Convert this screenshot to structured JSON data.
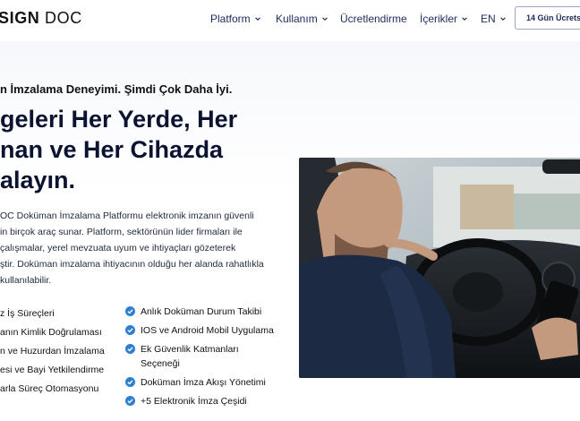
{
  "header": {
    "logo_bold": "SIGN",
    "logo_light": "DOC",
    "nav": [
      {
        "label": "Platform",
        "has_dropdown": true
      },
      {
        "label": "Kullanım",
        "has_dropdown": true
      },
      {
        "label": "Ücretlendirme",
        "has_dropdown": false
      },
      {
        "label": "İçerikler",
        "has_dropdown": true
      },
      {
        "label": "EN",
        "has_dropdown": true
      }
    ],
    "trial_button": "14 Gün Ücretsi"
  },
  "hero": {
    "eyebrow": "n İmzalama Deneyimi. Şimdi Çok Daha İyi.",
    "headline_lines": [
      "geleri Her Yerde, Her",
      "nan ve Her Cihazda",
      "alayın."
    ],
    "paragraph_lines": [
      "OC Doküman İmzalama Platformu elektronik imzanın güvenli",
      "in birçok araç sunar. Platform, sektörünün lider firmaları ile",
      "çalışmalar, yerel mevzuata uyum ve ihtiyaçları gözeterek",
      "ştir. Doküman imzalama ihtiyacının olduğu her alanda rahatlıkla",
      "kullanılabilir."
    ],
    "features_left": [
      "z İş Süreçleri",
      "anın Kimlik Doğrulaması",
      "n ve Huzurdan İmzalama",
      "esi ve Bayi Yetkilendirme",
      "arla Süreç Otomasyonu"
    ],
    "features_right": [
      "Anlık Doküman Durum Takibi",
      "IOS ve Android Mobil Uygulama",
      "Ek Güvenlik Katmanları Seçeneği",
      "Doküman İmza Akışı Yönetimi",
      "+5 Elektronik İmza Çeşidi"
    ]
  },
  "colors": {
    "nav_text": "#1f2a5a",
    "check_accent": "#2f7fd1",
    "headline": "#0b1330"
  },
  "icons": [
    "chevron-down-icon",
    "check-circle-icon"
  ]
}
